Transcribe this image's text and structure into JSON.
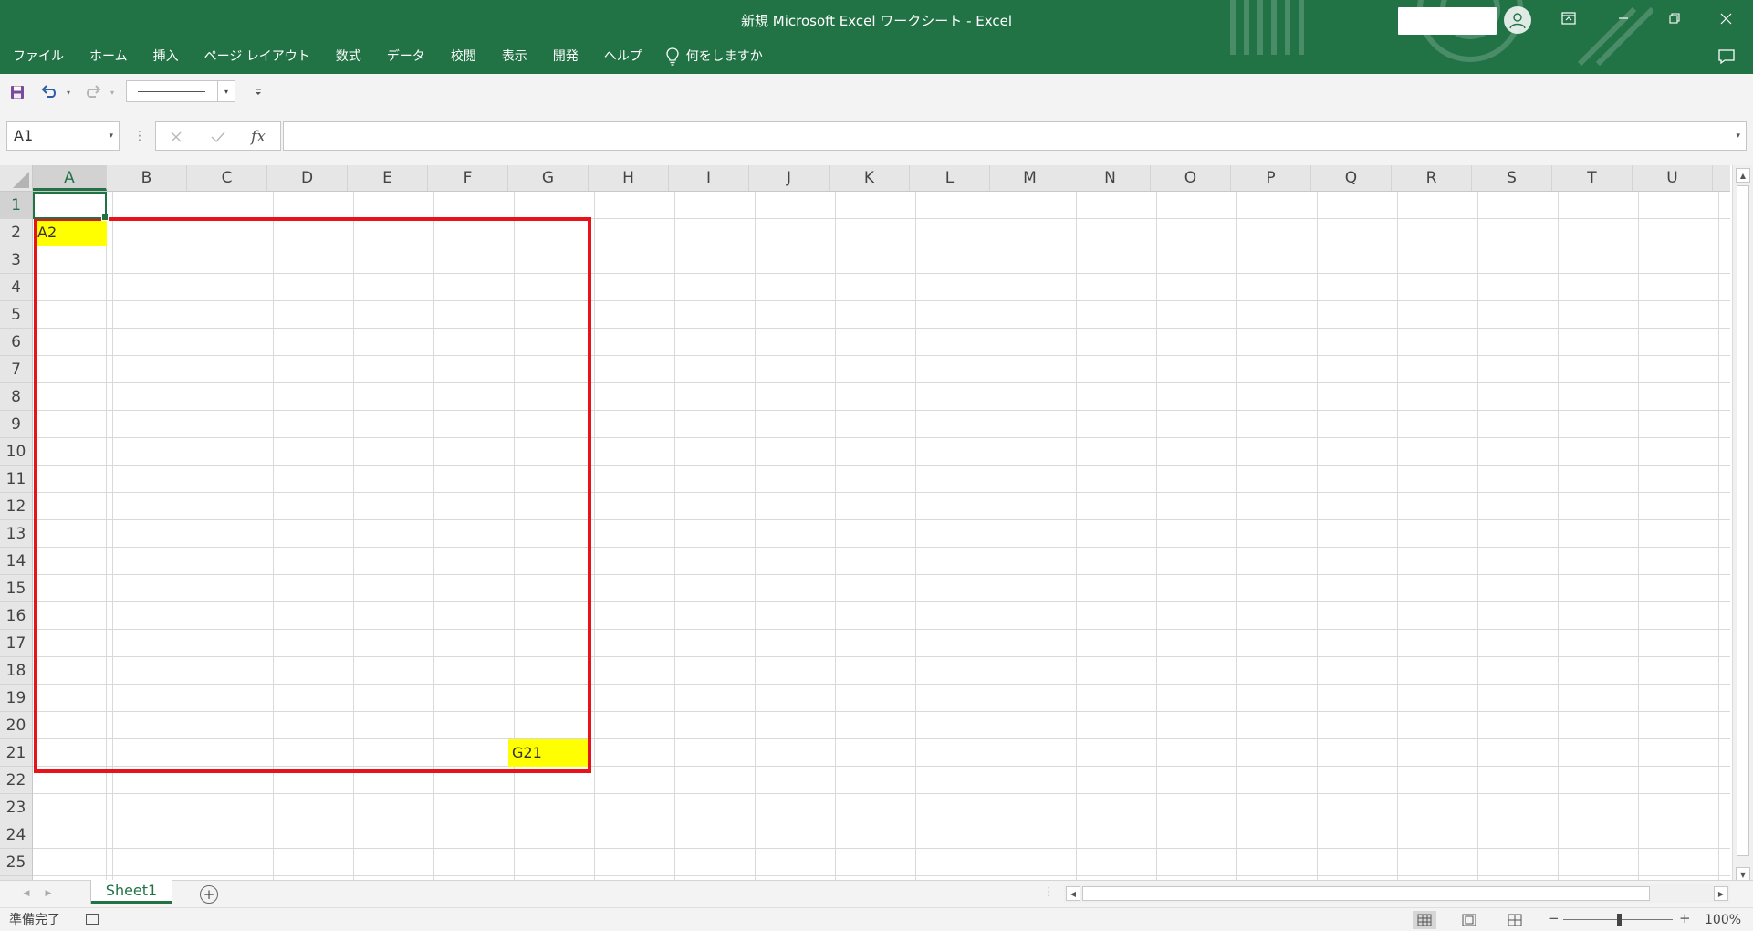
{
  "window": {
    "title": "新規 Microsoft Excel ワークシート  -  Excel"
  },
  "ribbon": {
    "tabs": [
      "ファイル",
      "ホーム",
      "挿入",
      "ページ レイアウト",
      "数式",
      "データ",
      "校閲",
      "表示",
      "開発",
      "ヘルプ"
    ],
    "tell_me": "何をしますか"
  },
  "formula_bar": {
    "name_box": "A1",
    "fx_label": "fx",
    "value": ""
  },
  "grid": {
    "columns": [
      "A",
      "B",
      "C",
      "D",
      "E",
      "F",
      "G",
      "H",
      "I",
      "J",
      "K",
      "L",
      "M",
      "N",
      "O",
      "P",
      "Q",
      "R",
      "S",
      "T",
      "U"
    ],
    "rows": [
      "1",
      "2",
      "3",
      "4",
      "5",
      "6",
      "7",
      "8",
      "9",
      "10",
      "11",
      "12",
      "13",
      "14",
      "15",
      "16",
      "17",
      "18",
      "19",
      "20",
      "21",
      "22",
      "23",
      "24",
      "25"
    ],
    "active_cell": "A1",
    "cells": [
      {
        "ref": "A2",
        "value": "A2",
        "fill": "#ffff00"
      },
      {
        "ref": "G21",
        "value": "G21",
        "fill": "#ffff00"
      }
    ],
    "highlight_range": {
      "from": "A2",
      "to": "G21",
      "border_color": "#e8121b"
    }
  },
  "sheets": {
    "tabs": [
      "Sheet1"
    ],
    "active": "Sheet1"
  },
  "status": {
    "ready_text": "準備完了",
    "zoom": "100%"
  },
  "colors": {
    "excel_green": "#217346",
    "highlight_fill": "#ffff00",
    "range_border": "#e8121b"
  }
}
